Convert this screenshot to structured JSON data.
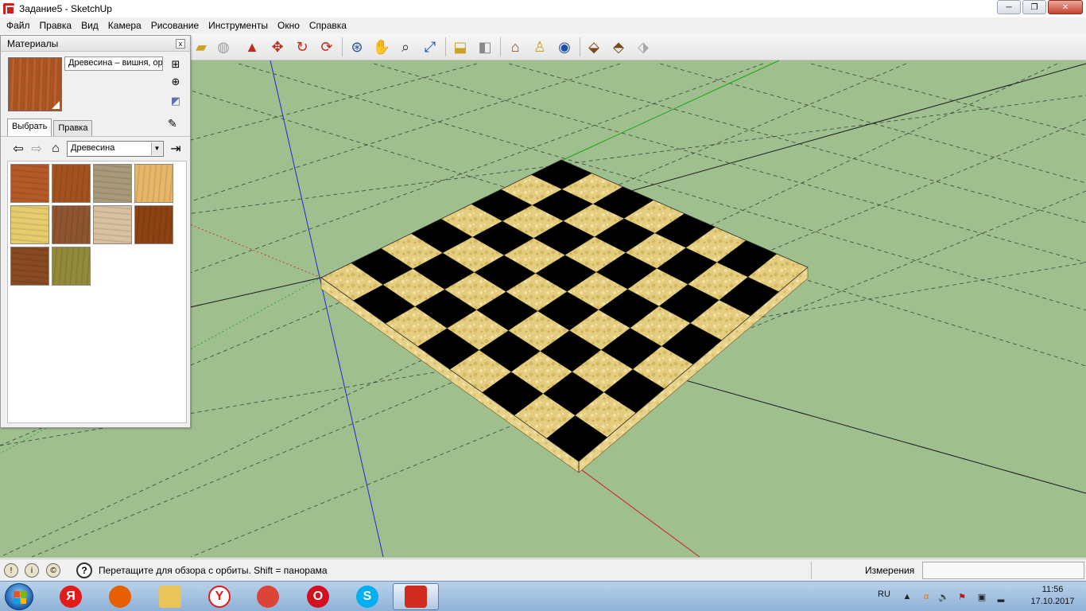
{
  "window": {
    "title": "Задание5 - SketchUp",
    "controls": {
      "minimize": "─",
      "maximize": "❐",
      "close": "✕"
    }
  },
  "menu": {
    "items": [
      "Файл",
      "Правка",
      "Вид",
      "Камера",
      "Рисование",
      "Инструменты",
      "Окно",
      "Справка"
    ]
  },
  "toolbar": {
    "icons": [
      "tape-measure-icon",
      "paint-bucket-icon",
      "push-pull-icon",
      "move-icon",
      "rotate-icon",
      "follow-me-icon",
      "orbit-icon",
      "pan-icon",
      "zoom-icon",
      "zoom-extents-icon",
      "top-view-icon",
      "section-plane-icon",
      "warehouse-icon",
      "position-camera-icon",
      "get-models-icon",
      "share-model-icon",
      "component-icon",
      "extension-icon"
    ]
  },
  "materials_panel": {
    "title": "Материалы",
    "close": "x",
    "current_material": "Древесина – вишня, ор",
    "tabs": [
      "Выбрать",
      "Правка"
    ],
    "active_tab": 0,
    "library": "Древесина",
    "swatch_colors": [
      "#b35a27",
      "#a3521f",
      "#a89a78",
      "#e8b66a",
      "#e7cc6e",
      "#8e5530",
      "#d9c0a1",
      "#8c4213",
      "#884a20",
      "#938a3a"
    ]
  },
  "status": {
    "hint": "Перетащите для обзора с орбиты.  Shift = панорама",
    "measurements_label": "Измерения",
    "measurements_value": ""
  },
  "taskbar": {
    "language": "RU",
    "time": "11:56",
    "date": "17.10.2017",
    "apps": [
      {
        "name": "yandex-browser",
        "color": "#e31b1b",
        "glyph": "Я"
      },
      {
        "name": "firefox",
        "color": "#e66000",
        "glyph": ""
      },
      {
        "name": "file-explorer",
        "color": "#e9c45a",
        "glyph": ""
      },
      {
        "name": "yandex",
        "color": "#ffffff",
        "glyph": "Y"
      },
      {
        "name": "chrome",
        "color": "#db4437",
        "glyph": ""
      },
      {
        "name": "opera",
        "color": "#d40f1f",
        "glyph": "O"
      },
      {
        "name": "skype",
        "color": "#00aff0",
        "glyph": "S"
      },
      {
        "name": "sketchup",
        "color": "#d12a1e",
        "glyph": ""
      }
    ],
    "active_app": 7
  }
}
